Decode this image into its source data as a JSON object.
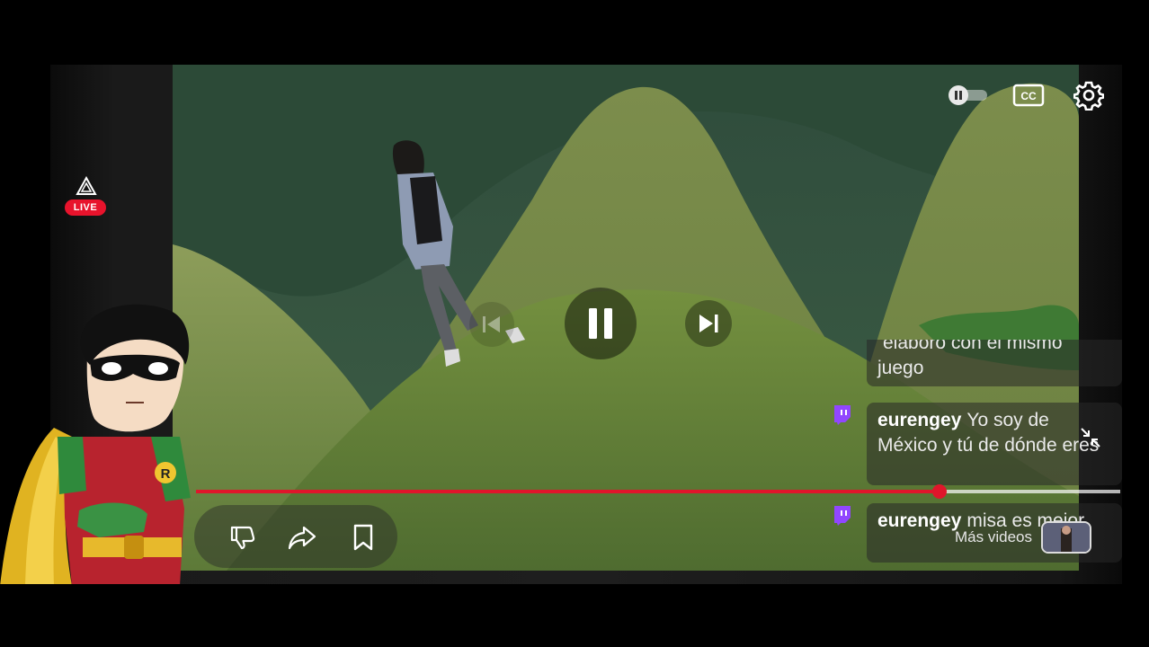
{
  "stream": {
    "live_label": "LIVE",
    "progress_fraction": 0.804
  },
  "chat": {
    "messages": [
      {
        "user": "",
        "text": "elaboró con el mismo juego"
      },
      {
        "user": "eurengey",
        "text": "Yo soy de México y tú de dónde eres"
      },
      {
        "user": "eurengey",
        "text": "misa es mejor"
      }
    ]
  },
  "controls": {
    "more_videos_label": "Más videos"
  },
  "icons": {
    "autoplay": "autoplay-toggle-icon",
    "captions": "closed-captions-icon",
    "settings": "gear-icon",
    "live": "live-triangle-icon",
    "previous": "skip-previous-icon",
    "pause": "pause-icon",
    "next": "skip-next-icon",
    "dislike": "thumbs-down-icon",
    "share": "share-arrow-icon",
    "save": "bookmark-icon",
    "collapse": "collapse-arrows-icon",
    "chat_platform": "twitch-icon"
  },
  "colors": {
    "accent": "#e0162b",
    "live_badge": "#e8132c",
    "twitch": "#9146ff"
  }
}
